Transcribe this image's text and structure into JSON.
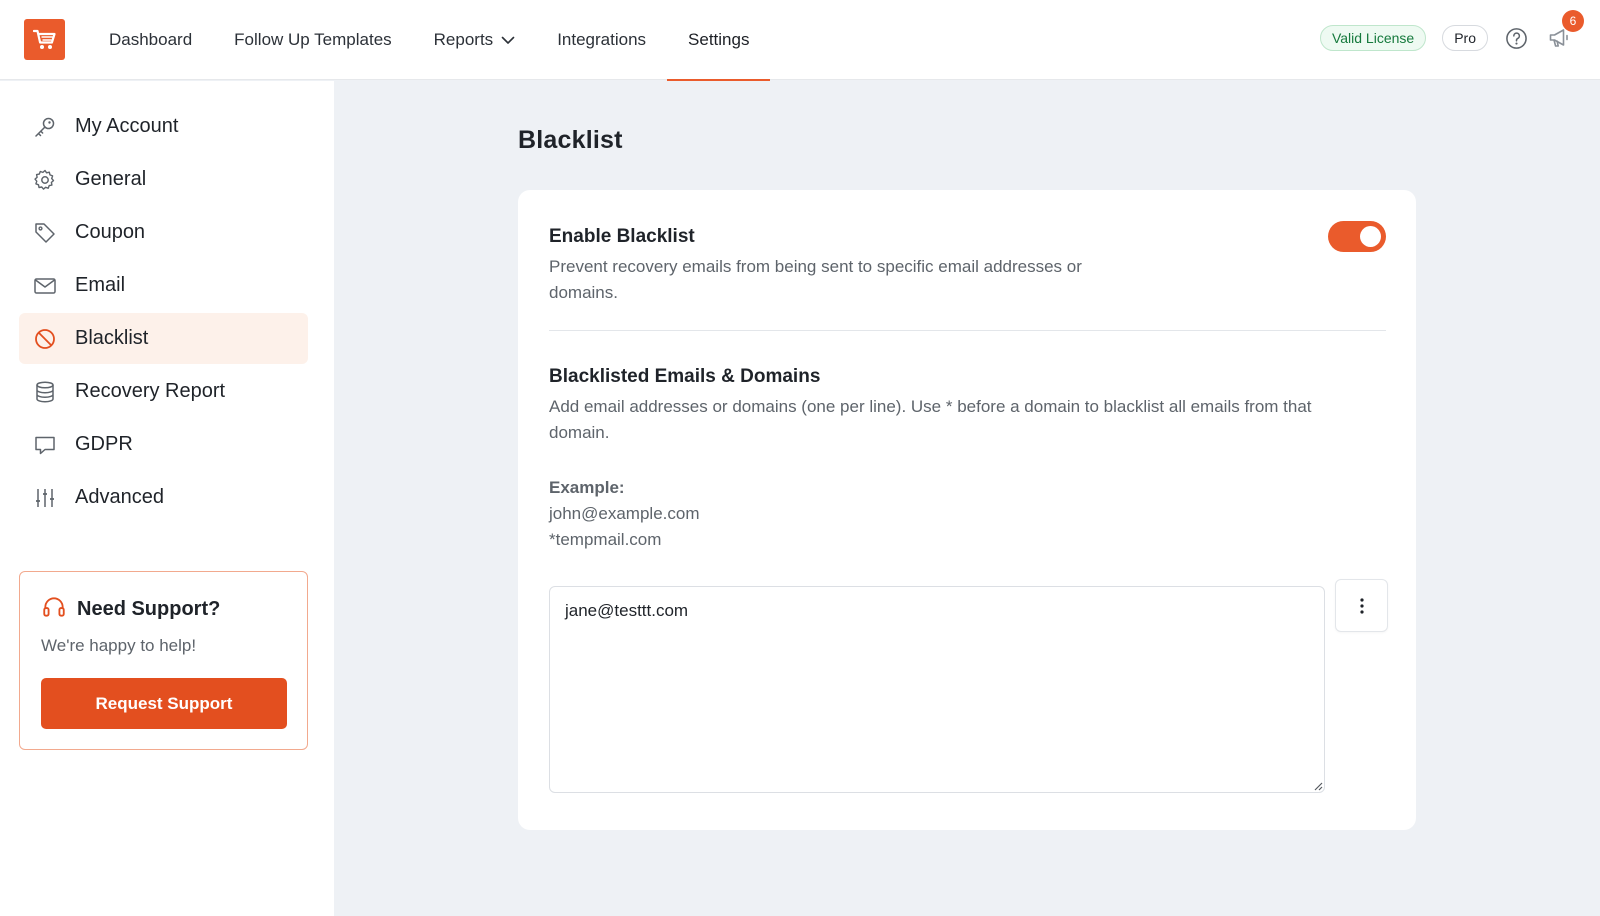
{
  "app": {
    "logo_icon": "shopping-cart-icon",
    "brand_color": "#ea5b2c"
  },
  "nav": {
    "items": [
      {
        "label": "Dashboard"
      },
      {
        "label": "Follow Up Templates"
      },
      {
        "label": "Reports"
      },
      {
        "label": "Integrations"
      },
      {
        "label": "Settings",
        "active": true
      }
    ]
  },
  "topright": {
    "license_label": "Valid License",
    "plan_label": "Pro",
    "notification_count": "6"
  },
  "sidebar": {
    "items": [
      {
        "label": "My Account",
        "icon": "key-icon"
      },
      {
        "label": "General",
        "icon": "gear-icon"
      },
      {
        "label": "Coupon",
        "icon": "tag-icon"
      },
      {
        "label": "Email",
        "icon": "envelope-icon"
      },
      {
        "label": "Blacklist",
        "icon": "ban-icon",
        "active": true
      },
      {
        "label": "Recovery Report",
        "icon": "database-icon"
      },
      {
        "label": "GDPR",
        "icon": "chat-bubble-icon"
      },
      {
        "label": "Advanced",
        "icon": "sliders-icon"
      }
    ]
  },
  "support": {
    "title": "Need Support?",
    "subtitle": "We're happy to help!",
    "button_label": "Request Support"
  },
  "main": {
    "page_title": "Blacklist",
    "enable": {
      "title": "Enable Blacklist",
      "description_line1": "Prevent recovery emails from being sent to specific email addresses or",
      "description_line2": "domains.",
      "enabled": true
    },
    "list": {
      "title": "Blacklisted Emails & Domains",
      "description_line1": "Add email addresses or domains (one per line). Use * before a domain to blacklist all emails from that",
      "description_line2": "domain.",
      "example_label": "Example:",
      "examples": [
        "john@example.com",
        "*tempmail.com"
      ],
      "value": "jane@testtt.com"
    }
  }
}
